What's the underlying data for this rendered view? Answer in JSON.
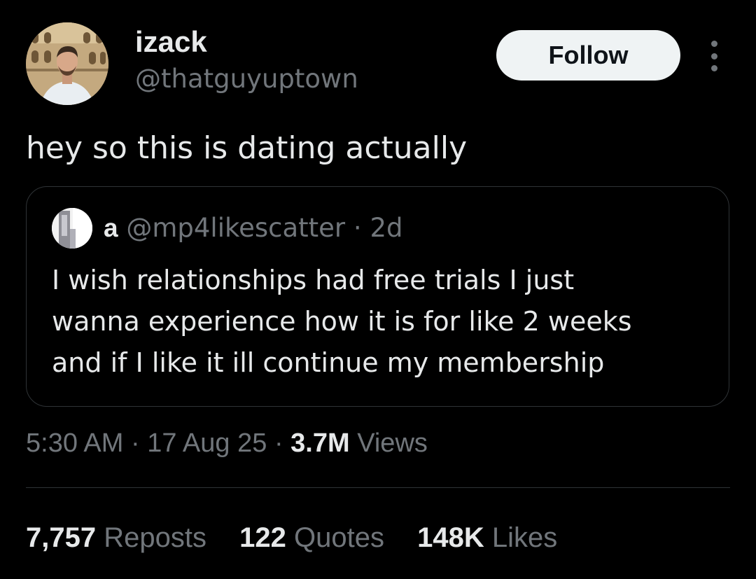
{
  "author": {
    "display_name": "izack",
    "handle": "@thatguyuptown",
    "avatar_icon": "profile-photo-icon"
  },
  "actions": {
    "follow_label": "Follow",
    "more_icon": "more-options-icon"
  },
  "tweet": {
    "text": "hey so this is dating actually"
  },
  "quoted": {
    "name": "a",
    "handle": "@mp4likescatter",
    "separator": "·",
    "age": "2d",
    "text": "I wish relationships had free trials I just\nwanna experience how it is for like 2 weeks\nand if I like it ill continue my membership",
    "avatar_icon": "quoted-profile-photo-icon"
  },
  "meta": {
    "time": "5:30 AM",
    "sep1": "·",
    "date": "17 Aug 25",
    "sep2": "·",
    "views_count": "3.7M",
    "views_label": "Views"
  },
  "engagement": {
    "reposts_count": "7,757",
    "reposts_label": "Reposts",
    "quotes_count": "122",
    "quotes_label": "Quotes",
    "likes_count": "148K",
    "likes_label": "Likes"
  },
  "colors": {
    "background": "#000000",
    "primary_text": "#e7e9ea",
    "secondary_text": "#71767b",
    "border": "#2f3336",
    "follow_button_bg": "#eff3f4",
    "follow_button_text": "#0f1419"
  }
}
